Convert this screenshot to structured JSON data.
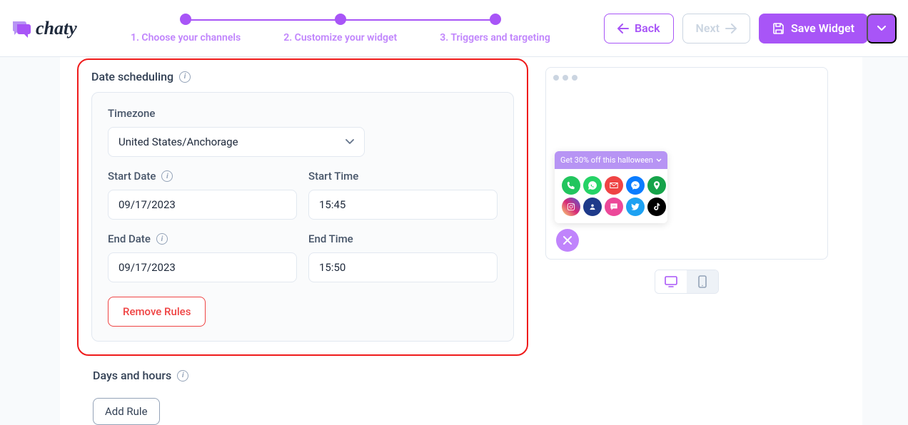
{
  "logo": {
    "word": "chaty"
  },
  "steps": [
    {
      "label": "1. Choose your channels"
    },
    {
      "label": "2. Customize your widget"
    },
    {
      "label": "3. Triggers and targeting"
    }
  ],
  "header_buttons": {
    "back": "Back",
    "next": "Next",
    "save": "Save Widget"
  },
  "date_scheduling": {
    "title": "Date scheduling",
    "timezone_label": "Timezone",
    "timezone_value": "United States/Anchorage",
    "start_date_label": "Start Date",
    "start_date_value": "09/17/2023",
    "start_time_label": "Start Time",
    "start_time_value": "15:45",
    "end_date_label": "End Date",
    "end_date_value": "09/17/2023",
    "end_time_label": "End Time",
    "end_time_value": "15:50",
    "remove_rules": "Remove Rules"
  },
  "days_hours": {
    "title": "Days and hours",
    "add_rule": "Add Rule"
  },
  "preview": {
    "promo_text": "Get 30% off this halloween",
    "icons": [
      {
        "name": "phone",
        "bg": "#22c55e"
      },
      {
        "name": "whatsapp",
        "bg": "#25d366"
      },
      {
        "name": "email",
        "bg": "#ef4444"
      },
      {
        "name": "messenger",
        "bg": "#0a7cff"
      },
      {
        "name": "map",
        "bg": "#16a34a"
      },
      {
        "name": "instagram",
        "bg": "linear-gradient(45deg,#feda75,#d62976,#4f5bd5)"
      },
      {
        "name": "contact",
        "bg": "#1e3a8a"
      },
      {
        "name": "sms",
        "bg": "#ec4899"
      },
      {
        "name": "twitter",
        "bg": "#1da1f2"
      },
      {
        "name": "tiktok",
        "bg": "#000000"
      }
    ]
  }
}
